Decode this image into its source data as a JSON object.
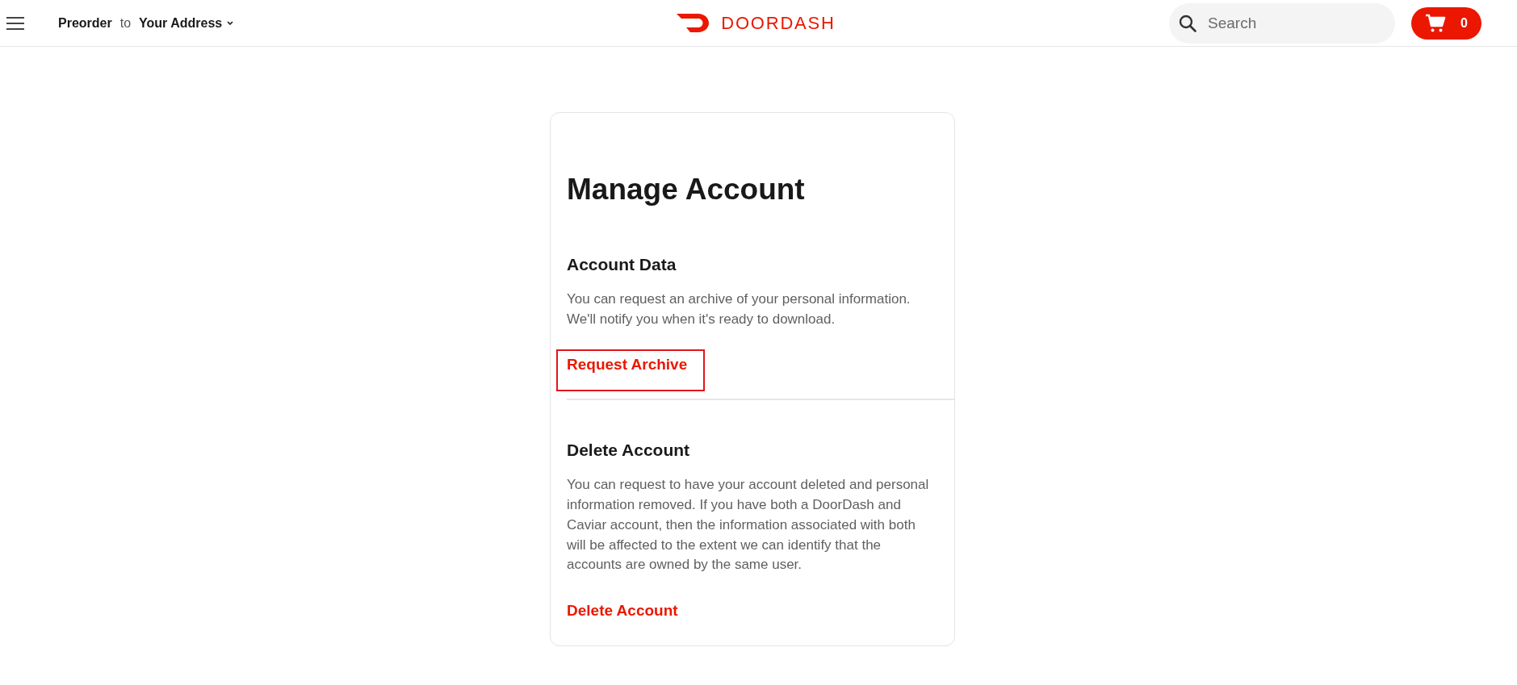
{
  "header": {
    "delivery": {
      "mode": "Preorder",
      "connector": "to",
      "address": "Your Address"
    },
    "logo": {
      "wordmark": "DOORDASH"
    },
    "search": {
      "placeholder": "Search"
    },
    "cart": {
      "count": "0"
    }
  },
  "card": {
    "title": "Manage Account",
    "sections": [
      {
        "heading": "Account Data",
        "text": "You can request an archive of your personal information. We'll notify you when it's ready to download.",
        "link": {
          "label": "Request Archive",
          "highlighted": true
        }
      },
      {
        "heading": "Delete Account",
        "text": "You can request to have your account deleted and personal information removed. If you have both a DoorDash and Caviar account, then the information associated with both will be affected to the extent we can identify that the accounts are owned by the same user.",
        "link": {
          "label": "Delete Account",
          "highlighted": false
        }
      }
    ]
  }
}
